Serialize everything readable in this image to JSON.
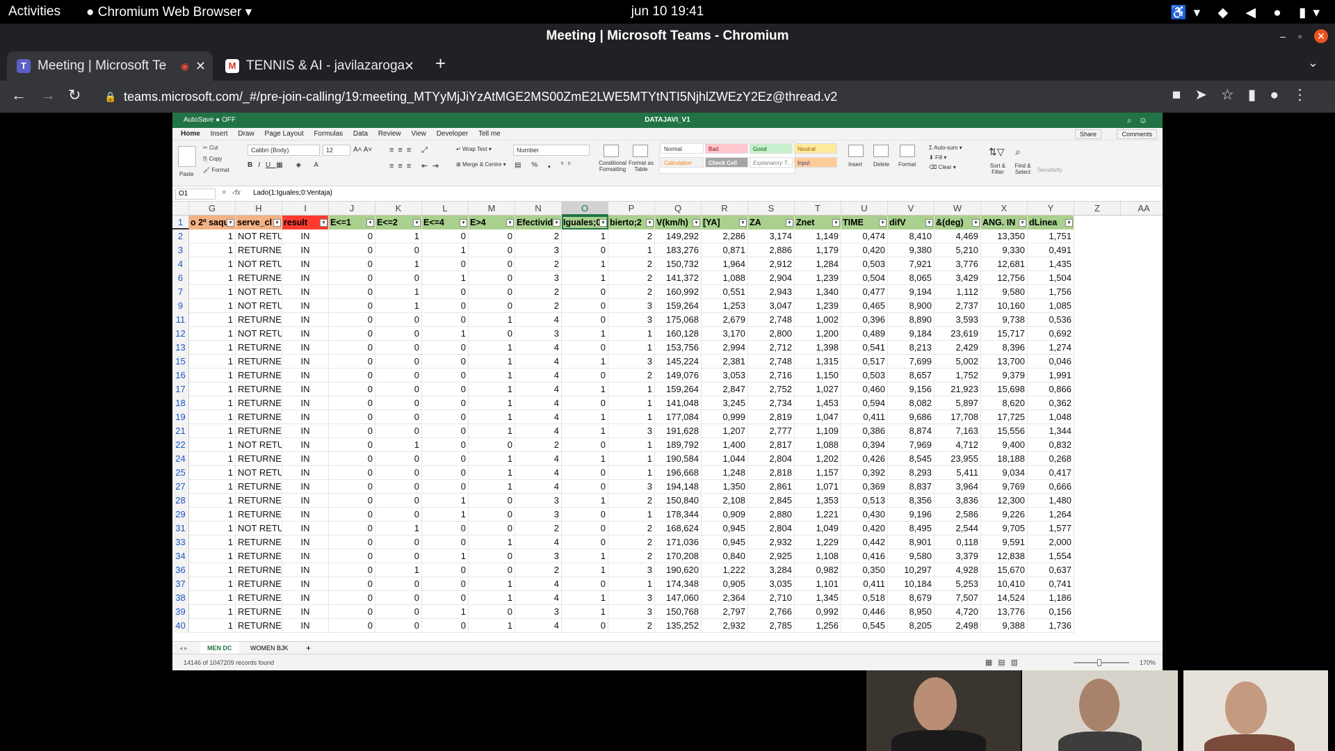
{
  "system": {
    "activities": "Activities",
    "app_menu": "Chromium Web Browser",
    "clock": "jun 10  19:41"
  },
  "window": {
    "title": "Meeting | Microsoft Teams - Chromium"
  },
  "tabs": [
    {
      "label": "Meeting | Microsoft Te",
      "favicon": "teams-icon"
    },
    {
      "label": "TENNIS & AI - javilazaroga",
      "favicon": "gmail-icon"
    }
  ],
  "omnibox": {
    "url": "teams.microsoft.com/_#/pre-join-calling/19:meeting_MTYyMjJiYzAtMGE2MS00ZmE2LWE5MTYtNTI5NjhlZWEzY2Ez@thread.v2"
  },
  "excel": {
    "autosave": "AutoSave ● OFF",
    "doc_title": "DATAJAVI_V1",
    "menu": [
      "Home",
      "Insert",
      "Draw",
      "Page Layout",
      "Formulas",
      "Data",
      "Review",
      "View",
      "Developer",
      "Tell me"
    ],
    "share": "Share",
    "comments": "Comments",
    "ribbon": {
      "paste": "Paste",
      "cut": "Cut",
      "copy": "Copy",
      "format": "Format",
      "font": "Calibri (Body)",
      "size": "12",
      "wrap": "Wrap Text",
      "merge": "Merge & Centre",
      "number_format": "Number",
      "cond": "Conditional Formatting",
      "fmt_table": "Format as Table",
      "styles": [
        "Normal",
        "Bad",
        "Good",
        "Neutral",
        "Calculation",
        "Check Cell",
        "Explanatory T...",
        "Input"
      ],
      "insert": "Insert",
      "delete": "Delete",
      "format2": "Format",
      "autosum": "Auto-sum",
      "fill": "Fill",
      "clear": "Clear",
      "sort": "Sort & Filter",
      "find": "Find & Select",
      "sensitivity": "Sensitivity"
    },
    "namebox": "O1",
    "formula": "Lado(1:Iguales;0:Ventaja)",
    "col_letters": [
      "G",
      "H",
      "I",
      "J",
      "K",
      "L",
      "M",
      "N",
      "O",
      "P",
      "Q",
      "R",
      "S",
      "T",
      "U",
      "V",
      "W",
      "X",
      "Y",
      "Z",
      "AA"
    ],
    "headers": [
      "o 2º saqu",
      "serve_cl",
      "result",
      "E<=1",
      "E<=2",
      "E<=4",
      "E>4",
      "Efectivid",
      "Iguales;0",
      "bierto;2",
      "V(km/h)",
      "[YA]",
      "ZA",
      "Znet",
      "TIME",
      "difV",
      "&(deg)",
      "ANG. IN",
      "dLinea"
    ],
    "row_numbers": [
      "1",
      "2",
      "3",
      "4",
      "6",
      "7",
      "9",
      "11",
      "12",
      "13",
      "15",
      "16",
      "17",
      "18",
      "19",
      "21",
      "22",
      "24",
      "25",
      "27",
      "28",
      "29",
      "31",
      "33",
      "34",
      "36",
      "37",
      "38",
      "39",
      "40"
    ],
    "rows": [
      [
        "1",
        "NOT RETU",
        "IN",
        "0",
        "1",
        "0",
        "0",
        "2",
        "1",
        "2",
        "149,292",
        "2,286",
        "3,174",
        "1,149",
        "0,474",
        "8,410",
        "4,469",
        "13,350",
        "1,751"
      ],
      [
        "1",
        "RETURNEC",
        "IN",
        "0",
        "0",
        "1",
        "0",
        "3",
        "0",
        "1",
        "183,276",
        "0,871",
        "2,886",
        "1,179",
        "0,420",
        "9,380",
        "5,210",
        "9,330",
        "0,491"
      ],
      [
        "1",
        "NOT RETU",
        "IN",
        "0",
        "1",
        "0",
        "0",
        "2",
        "1",
        "2",
        "150,732",
        "1,964",
        "2,912",
        "1,284",
        "0,503",
        "7,921",
        "3,776",
        "12,681",
        "1,435"
      ],
      [
        "1",
        "RETURNEC",
        "IN",
        "0",
        "0",
        "1",
        "0",
        "3",
        "1",
        "2",
        "141,372",
        "1,088",
        "2,904",
        "1,239",
        "0,504",
        "8,065",
        "3,429",
        "12,756",
        "1,504"
      ],
      [
        "1",
        "NOT RETU",
        "IN",
        "0",
        "1",
        "0",
        "0",
        "2",
        "0",
        "2",
        "160,992",
        "0,551",
        "2,943",
        "1,340",
        "0,477",
        "9,194",
        "1,112",
        "9,580",
        "1,756"
      ],
      [
        "1",
        "NOT RETU",
        "IN",
        "0",
        "1",
        "0",
        "0",
        "2",
        "0",
        "3",
        "159,264",
        "1,253",
        "3,047",
        "1,239",
        "0,465",
        "8,900",
        "2,737",
        "10,160",
        "1,085"
      ],
      [
        "1",
        "RETURNEC",
        "IN",
        "0",
        "0",
        "0",
        "1",
        "4",
        "0",
        "3",
        "175,068",
        "2,679",
        "2,748",
        "1,002",
        "0,396",
        "8,890",
        "3,593",
        "9,738",
        "0,536"
      ],
      [
        "1",
        "NOT RETU",
        "IN",
        "0",
        "0",
        "1",
        "0",
        "3",
        "1",
        "1",
        "160,128",
        "3,170",
        "2,800",
        "1,200",
        "0,489",
        "9,184",
        "23,619",
        "15,717",
        "0,692"
      ],
      [
        "1",
        "RETURNEC",
        "IN",
        "0",
        "0",
        "0",
        "1",
        "4",
        "0",
        "1",
        "153,756",
        "2,994",
        "2,712",
        "1,398",
        "0,541",
        "8,213",
        "2,429",
        "8,396",
        "1,274"
      ],
      [
        "1",
        "RETURNEC",
        "IN",
        "0",
        "0",
        "0",
        "1",
        "4",
        "1",
        "3",
        "145,224",
        "2,381",
        "2,748",
        "1,315",
        "0,517",
        "7,699",
        "5,002",
        "13,700",
        "0,046"
      ],
      [
        "1",
        "RETURNEC",
        "IN",
        "0",
        "0",
        "0",
        "1",
        "4",
        "0",
        "2",
        "149,076",
        "3,053",
        "2,716",
        "1,150",
        "0,503",
        "8,657",
        "1,752",
        "9,379",
        "1,991"
      ],
      [
        "1",
        "RETURNEC",
        "IN",
        "0",
        "0",
        "0",
        "1",
        "4",
        "1",
        "1",
        "159,264",
        "2,847",
        "2,752",
        "1,027",
        "0,460",
        "9,156",
        "21,923",
        "15,698",
        "0,866"
      ],
      [
        "1",
        "RETURNEC",
        "IN",
        "0",
        "0",
        "0",
        "1",
        "4",
        "0",
        "1",
        "141,048",
        "3,245",
        "2,734",
        "1,453",
        "0,594",
        "8,082",
        "5,897",
        "8,620",
        "0,362"
      ],
      [
        "1",
        "RETURNEC",
        "IN",
        "0",
        "0",
        "0",
        "1",
        "4",
        "1",
        "1",
        "177,084",
        "0,999",
        "2,819",
        "1,047",
        "0,411",
        "9,686",
        "17,708",
        "17,725",
        "1,048"
      ],
      [
        "1",
        "RETURNEC",
        "IN",
        "0",
        "0",
        "0",
        "1",
        "4",
        "1",
        "3",
        "191,628",
        "1,207",
        "2,777",
        "1,109",
        "0,386",
        "8,874",
        "7,163",
        "15,556",
        "1,344"
      ],
      [
        "1",
        "NOT RETU",
        "IN",
        "0",
        "1",
        "0",
        "0",
        "2",
        "0",
        "1",
        "189,792",
        "1,400",
        "2,817",
        "1,088",
        "0,394",
        "7,969",
        "4,712",
        "9,400",
        "0,832"
      ],
      [
        "1",
        "RETURNEC",
        "IN",
        "0",
        "0",
        "0",
        "1",
        "4",
        "1",
        "1",
        "190,584",
        "1,044",
        "2,804",
        "1,202",
        "0,426",
        "8,545",
        "23,955",
        "18,188",
        "0,268"
      ],
      [
        "1",
        "NOT RETU",
        "IN",
        "0",
        "0",
        "0",
        "1",
        "4",
        "0",
        "1",
        "196,668",
        "1,248",
        "2,818",
        "1,157",
        "0,392",
        "8,293",
        "5,411",
        "9,034",
        "0,417"
      ],
      [
        "1",
        "RETURNEC",
        "IN",
        "0",
        "0",
        "0",
        "1",
        "4",
        "0",
        "3",
        "194,148",
        "1,350",
        "2,861",
        "1,071",
        "0,369",
        "8,837",
        "3,964",
        "9,769",
        "0,666"
      ],
      [
        "1",
        "RETURNEC",
        "IN",
        "0",
        "0",
        "1",
        "0",
        "3",
        "1",
        "2",
        "150,840",
        "2,108",
        "2,845",
        "1,353",
        "0,513",
        "8,356",
        "3,836",
        "12,300",
        "1,480"
      ],
      [
        "1",
        "RETURNEC",
        "IN",
        "0",
        "0",
        "1",
        "0",
        "3",
        "0",
        "1",
        "178,344",
        "0,909",
        "2,880",
        "1,221",
        "0,430",
        "9,196",
        "2,586",
        "9,226",
        "1,264"
      ],
      [
        "1",
        "NOT RETU",
        "IN",
        "0",
        "1",
        "0",
        "0",
        "2",
        "0",
        "2",
        "168,624",
        "0,945",
        "2,804",
        "1,049",
        "0,420",
        "8,495",
        "2,544",
        "9,705",
        "1,577"
      ],
      [
        "1",
        "RETURNEC",
        "IN",
        "0",
        "0",
        "0",
        "1",
        "4",
        "0",
        "2",
        "171,036",
        "0,945",
        "2,932",
        "1,229",
        "0,442",
        "8,901",
        "0,118",
        "9,591",
        "2,000"
      ],
      [
        "1",
        "RETURNEC",
        "IN",
        "0",
        "0",
        "1",
        "0",
        "3",
        "1",
        "2",
        "170,208",
        "0,840",
        "2,925",
        "1,108",
        "0,416",
        "9,580",
        "3,379",
        "12,838",
        "1,554"
      ],
      [
        "1",
        "RETURNEC",
        "IN",
        "0",
        "1",
        "0",
        "0",
        "2",
        "1",
        "3",
        "190,620",
        "1,222",
        "3,284",
        "0,982",
        "0,350",
        "10,297",
        "4,928",
        "15,670",
        "0,637"
      ],
      [
        "1",
        "RETURNEC",
        "IN",
        "0",
        "0",
        "0",
        "1",
        "4",
        "0",
        "1",
        "174,348",
        "0,905",
        "3,035",
        "1,101",
        "0,411",
        "10,184",
        "5,253",
        "10,410",
        "0,741"
      ],
      [
        "1",
        "RETURNEC",
        "IN",
        "0",
        "0",
        "0",
        "1",
        "4",
        "1",
        "3",
        "147,060",
        "2,364",
        "2,710",
        "1,345",
        "0,518",
        "8,679",
        "7,507",
        "14,524",
        "1,186"
      ],
      [
        "1",
        "RETURNEC",
        "IN",
        "0",
        "0",
        "1",
        "0",
        "3",
        "1",
        "3",
        "150,768",
        "2,797",
        "2,766",
        "0,992",
        "0,446",
        "8,950",
        "4,720",
        "13,776",
        "0,156"
      ],
      [
        "1",
        "RETURNEC",
        "IN",
        "0",
        "0",
        "0",
        "1",
        "4",
        "0",
        "2",
        "135,252",
        "2,932",
        "2,785",
        "1,256",
        "0,545",
        "8,205",
        "2,498",
        "9,388",
        "1,736"
      ]
    ],
    "sheets": [
      "MEN DC",
      "WOMEN BJK"
    ],
    "status": "14146 of 1047209 records found",
    "zoom": "170%"
  },
  "colors": {
    "header_orange": "#f4b183",
    "header_red": "#ff3b30",
    "header_green": "#a9d08e",
    "excel_green": "#217346"
  }
}
